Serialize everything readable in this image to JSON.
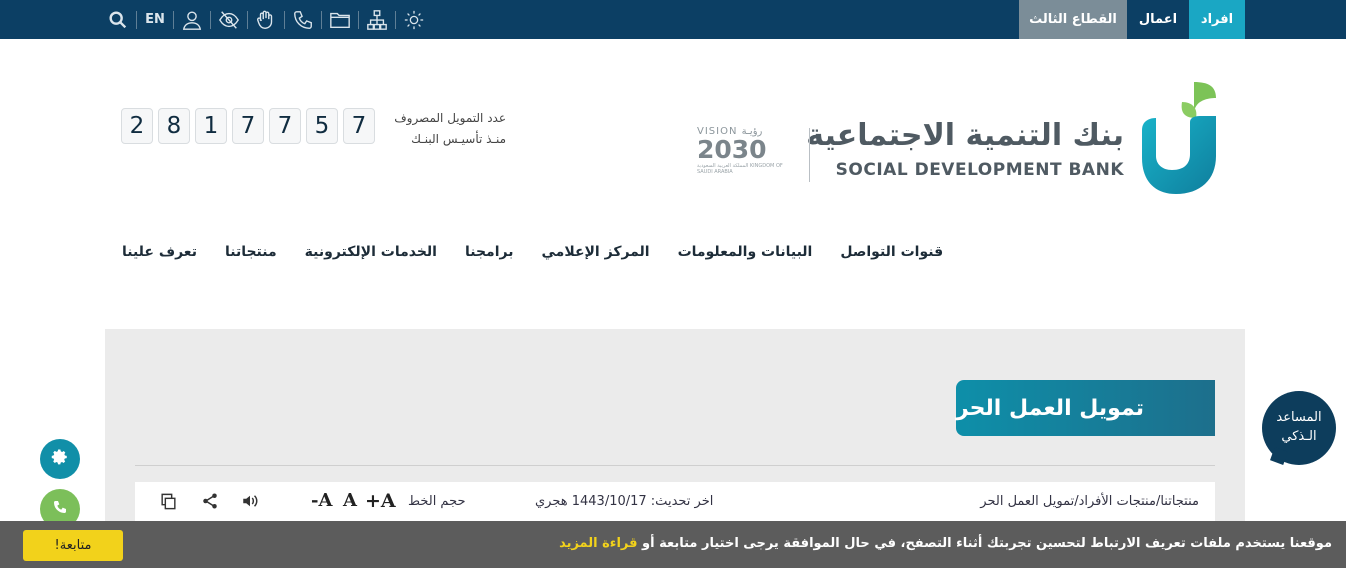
{
  "topbar": {
    "tabs": [
      {
        "label": "افراد"
      },
      {
        "label": "اعمال"
      },
      {
        "label": "القطاع الثالث"
      }
    ],
    "lang_label": "EN",
    "icons": [
      "search-icon",
      "user-icon",
      "eye-slash-icon",
      "sign-language-icon",
      "phone-icon",
      "folder-icon",
      "sitemap-icon",
      "settings-sun-icon"
    ]
  },
  "header": {
    "bank_name_ar": "بنك التنمية الاجتماعية",
    "bank_name_en": "SOCIAL DEVELOPMENT BANK",
    "vision_top": "VISION رؤيـة",
    "vision_year": "2030",
    "vision_sub": "المملكة العربية السعودية KINGDOM OF SAUDI ARABIA",
    "counter_label_1": "عدد التمويل المصروف",
    "counter_label_2": "منـذ تأسيـس البنـك",
    "counter_digits": [
      "2",
      "8",
      "1",
      "7",
      "7",
      "5",
      "7"
    ]
  },
  "nav": {
    "items": [
      {
        "label": "تعرف علينا"
      },
      {
        "label": "منتجاتنا"
      },
      {
        "label": "الخدمات الإلكترونية"
      },
      {
        "label": "برامجنا"
      },
      {
        "label": "المركز الإعلامي"
      },
      {
        "label": "البيانات والمعلومات"
      },
      {
        "label": "قنوات التواصل"
      }
    ]
  },
  "page": {
    "title": "تمويل العمل الحر",
    "breadcrumb": "منتجاتنا/منتجات الأفراد/تمويل العمل الحر",
    "update_label": "اخر تحديث: 1443/10/17 هجري",
    "font_size_label": "حجم الخط",
    "font_plus": "+A",
    "font_normal": "A",
    "font_minus": "-A"
  },
  "assistant": {
    "line1": "المساعد",
    "line2": "الـذكي"
  },
  "cookie": {
    "text": "موقعنا يستخدم ملفات تعريف الارتباط لتحسين تجربتك أثناء التصفح، في حال الموافقة يرجى اختيار متابعة أو",
    "link": "قراءة المزيد",
    "button": "متابعة!"
  },
  "colors": {
    "topbar": "#0c3f64",
    "tab_active": "#1aa7c4",
    "tab_third": "#7b8d98",
    "title_gradient_start": "#0e8fa9",
    "cookie_bg": "#5c5c5c",
    "cookie_accent": "#f2d21b",
    "side_settings": "#118fa8",
    "side_phone": "#7cbf5a"
  }
}
